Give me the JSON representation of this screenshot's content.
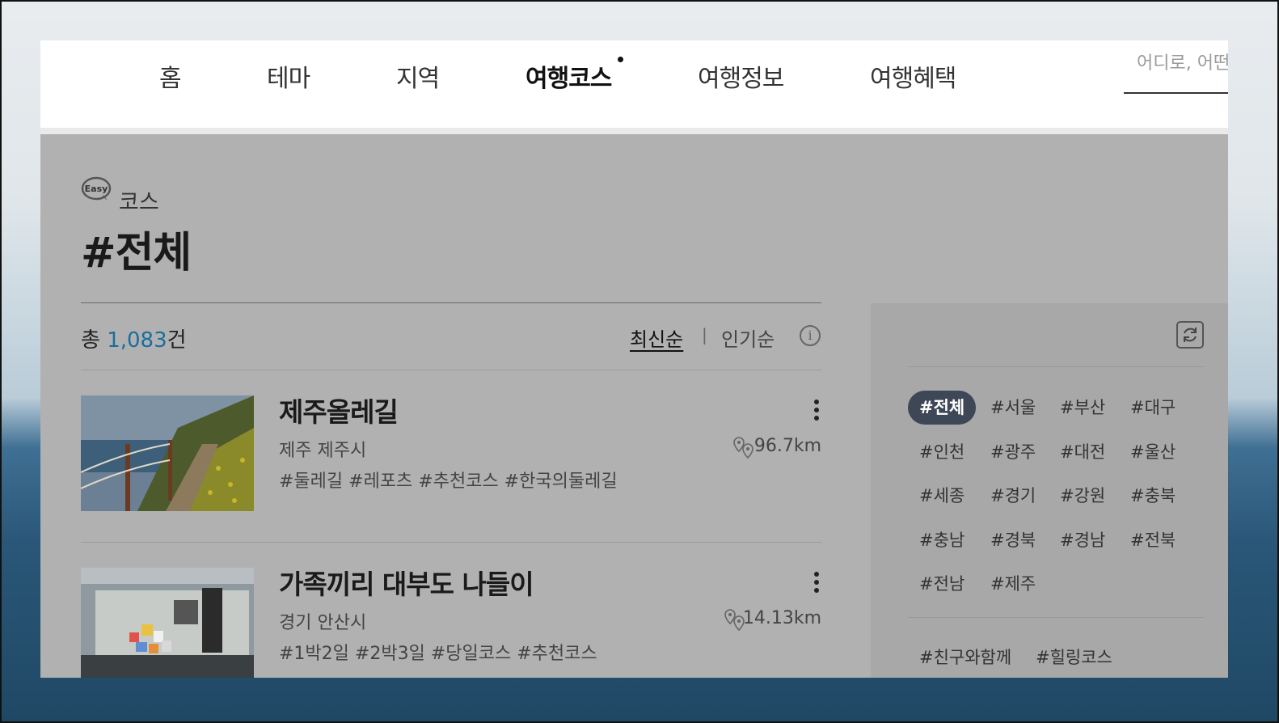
{
  "nav": {
    "items": [
      "홈",
      "테마",
      "지역",
      "여행코스",
      "여행정보",
      "여행혜택"
    ],
    "active": "여행코스"
  },
  "search": {
    "placeholder": "어디로, 어떤 여행을 떠날 예정인가요?"
  },
  "page": {
    "course_label": "코스",
    "title": "#전체"
  },
  "count": {
    "prefix": "총",
    "value": "1,083",
    "suffix": "건"
  },
  "sort": {
    "latest": "최신순",
    "popular": "인기순",
    "separator": "|"
  },
  "items": [
    {
      "title": "제주올레길",
      "location": "제주 제주시",
      "distance": "96.7km",
      "tags": "#둘레길 #레포츠 #추천코스 #한국의둘레길"
    },
    {
      "title": "가족끼리 대부도 나들이",
      "location": "경기 안산시",
      "distance": "14.13km",
      "tags": "#1박2일 #2박3일 #당일코스 #추천코스"
    }
  ],
  "regions": [
    "#전체",
    "#서울",
    "#부산",
    "#대구",
    "#인천",
    "#광주",
    "#대전",
    "#울산",
    "#세종",
    "#경기",
    "#강원",
    "#충북",
    "#충남",
    "#경북",
    "#경남",
    "#전북",
    "#전남",
    "#제주"
  ],
  "region_selected": "#전체",
  "themes": [
    "#친구와함께",
    "#힐링코스"
  ],
  "colors": {
    "accent": "#1a6e9f",
    "chip_active": "#3e4756"
  }
}
